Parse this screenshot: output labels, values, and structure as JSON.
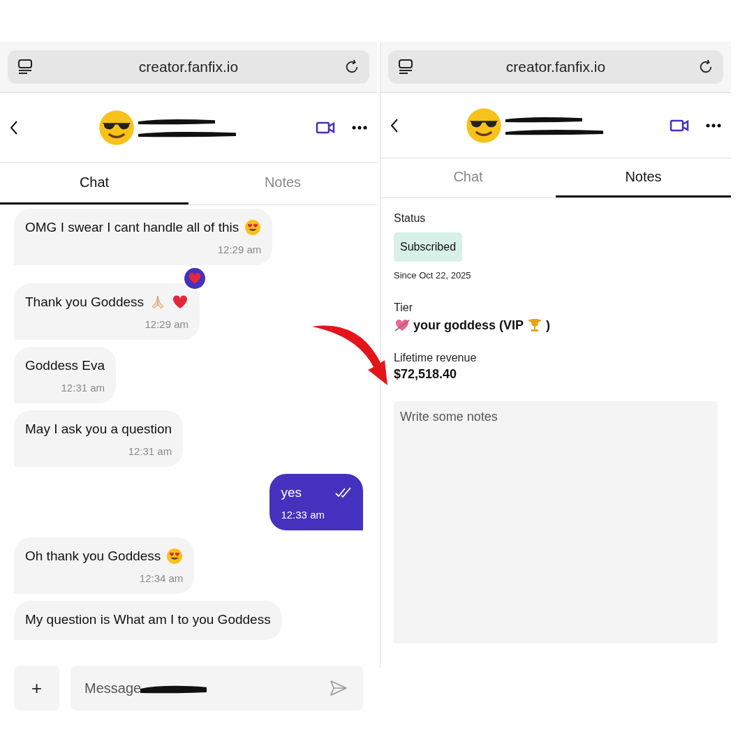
{
  "chat_screen": {
    "url": "creator.fanfix.io",
    "tabs": [
      {
        "label": "Chat",
        "selected": true
      },
      {
        "label": "Notes",
        "selected": false
      }
    ],
    "messages": [
      {
        "kind": "incoming",
        "text": "OMG I swear I cant handle all of this",
        "emoji": [
          {
            "kind": "heart_eyes"
          }
        ],
        "time": "12:29 am"
      },
      {
        "kind": "incoming",
        "text": "Thank you Goddess",
        "emoji": [
          {
            "kind": "folded_hands"
          },
          {
            "kind": "heart"
          }
        ],
        "time": "12:29 am",
        "reaction": {
          "kind": "heart"
        }
      },
      {
        "kind": "incoming",
        "text": "Goddess Eva",
        "time": "12:31 am"
      },
      {
        "kind": "incoming",
        "text": "May I ask you a question",
        "time": "12:31 am"
      },
      {
        "kind": "outgoing",
        "text": "yes",
        "time": "12:33 am",
        "read": true
      },
      {
        "kind": "incoming",
        "text": "Oh thank you Goddess",
        "emoji": [
          {
            "kind": "heart_eyes"
          }
        ],
        "time": "12:34 am"
      },
      {
        "kind": "incoming",
        "text": "My question is What am I to you Goddess"
      }
    ],
    "composer": {
      "add_label": "+",
      "placeholder": "Message"
    }
  },
  "notes_screen": {
    "url": "creator.fanfix.io",
    "tabs": [
      {
        "label": "Chat",
        "selected": false
      },
      {
        "label": "Notes",
        "selected": true
      }
    ],
    "status": {
      "label": "Status",
      "value": "Subscribed",
      "since": "Since Oct 22, 2025"
    },
    "tier": {
      "label": "Tier",
      "lead_emoji": {
        "kind": "cupid"
      },
      "text": "your goddess (VIP",
      "emoji": {
        "kind": "trophy"
      },
      "suffix": ")"
    },
    "revenue": {
      "label": "Lifetime revenue",
      "value": "$72,518.40"
    },
    "notes": {
      "placeholder": "Write some notes"
    }
  }
}
